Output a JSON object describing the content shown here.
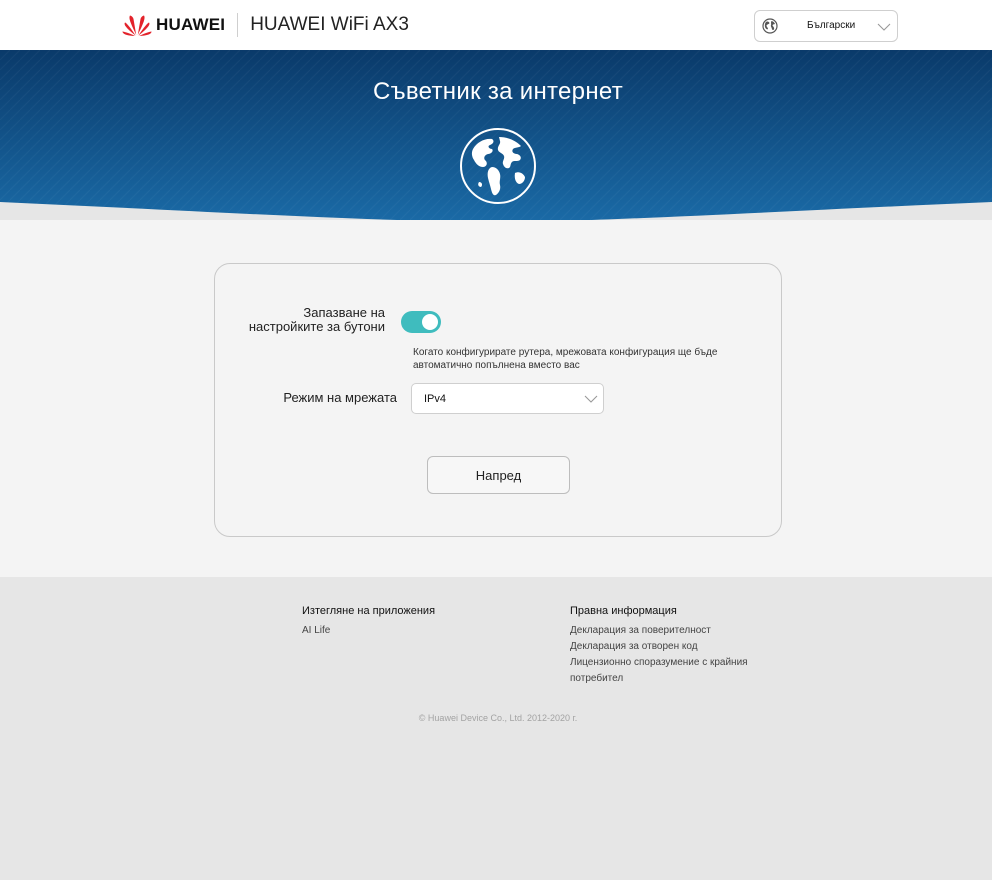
{
  "header": {
    "brand_name": "HUAWEI",
    "product_name": "HUAWEI WiFi AX3",
    "language": {
      "selected": "Български",
      "icon": "globe-icon"
    }
  },
  "banner": {
    "title": "Съветник за интернет",
    "icon": "globe-icon",
    "colors": {
      "top": "#0a3a6a",
      "bottom": "#1a6aa6"
    }
  },
  "form": {
    "toggle": {
      "label": "Запазване на настройките за бутони",
      "on": true,
      "hint": "Когато конфигурирате рутера, мрежовата конфигурация ще бъде автоматично попълнена вместо вас",
      "color": "#3fbcbe"
    },
    "network_mode": {
      "label": "Режим на мрежата",
      "value": "IPv4"
    },
    "next_label": "Напред"
  },
  "footer": {
    "apps": {
      "heading": "Изтегляне на приложения",
      "links": [
        "AI Life"
      ]
    },
    "legal": {
      "heading": "Правна информация",
      "links": [
        "Декларация за поверителност",
        "Декларация за отворен код",
        "Лицензионно споразумение с крайния потребител"
      ]
    },
    "copyright": "© Huawei Device Co., Ltd. 2012-2020 г."
  }
}
